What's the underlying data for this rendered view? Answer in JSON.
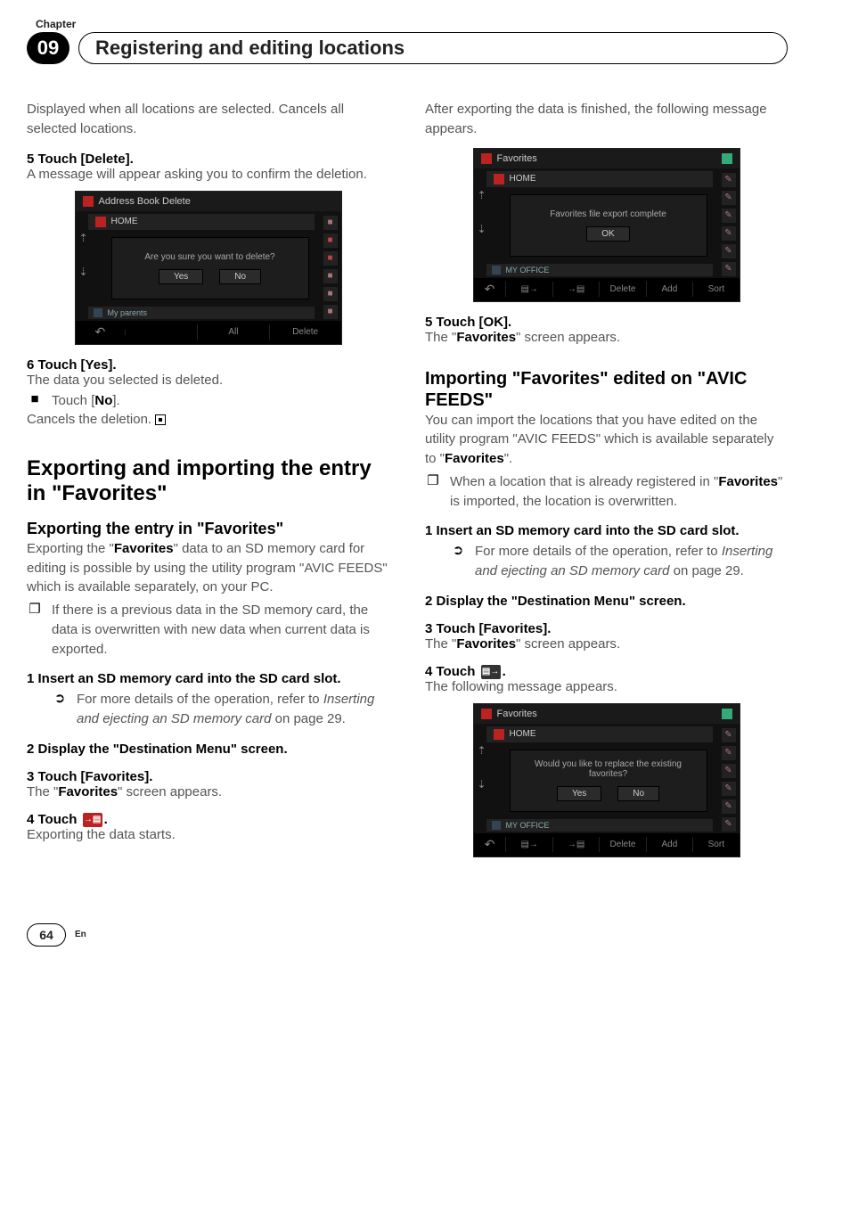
{
  "header": {
    "chapter_label": "Chapter",
    "chapter_number": "09",
    "title": "Registering and editing locations"
  },
  "left": {
    "intro": "Displayed when all locations are selected. Cancels all selected locations.",
    "step5_label": "5    Touch [Delete].",
    "step5_body": "A message will appear asking you to confirm the deletion.",
    "shot1": {
      "title": "Address Book Delete",
      "home": "HOME",
      "dialog_msg": "Are you sure you want to delete?",
      "yes": "Yes",
      "no": "No",
      "parents": "My parents",
      "footer_all": "All",
      "footer_delete": "Delete"
    },
    "step6_label": "6    Touch [Yes].",
    "step6_body": "The data you selected is deleted.",
    "bullet_touch_no_sym": "■",
    "bullet_touch_no": "Touch [",
    "bullet_touch_no_bold": "No",
    "bullet_touch_no_tail": "].",
    "cancels_deletion": "Cancels the deletion.",
    "h2": "Exporting and importing the entry in \"Favorites\"",
    "h3": "Exporting the entry in \"Favorites\"",
    "export_p1a": "Exporting the \"",
    "export_p1b": "Favorites",
    "export_p1c": "\" data to an SD memory card for editing is possible by using the utility program \"AVIC FEEDS\" which is available separately, on your PC.",
    "export_note_sym": "❐",
    "export_note": "If there is a previous data in the SD memory card, the data is overwritten with new data when current data is exported.",
    "step1_label": "1    Insert an SD memory card into the SD card slot.",
    "ref_sym": "➲",
    "ref_text_a": "For more details of the operation, refer to ",
    "ref_text_b": "Inserting and ejecting an SD memory card",
    "ref_text_c": " on page 29.",
    "step2_label": "2    Display the \"Destination Menu\" screen.",
    "step3_label": "3    Touch [Favorites].",
    "step3_body_a": "The \"",
    "step3_body_b": "Favorites",
    "step3_body_c": "\" screen appears.",
    "step4_label_a": "4    Touch ",
    "step4_label_b": ".",
    "step4_icon_glyph": "→▤",
    "step4_body": "Exporting the data starts."
  },
  "right": {
    "intro": "After exporting the data is finished, the following message appears.",
    "shot2": {
      "title": "Favorites",
      "home": "HOME",
      "dialog_msg": "Favorites file export complete",
      "ok": "OK",
      "office": "MY OFFICE",
      "f1": "▤→",
      "f2": "→▤",
      "f3": "Delete",
      "f4": "Add",
      "f5": "Sort"
    },
    "step5_label": "5    Touch [OK].",
    "step5_body_a": "The \"",
    "step5_body_b": "Favorites",
    "step5_body_c": "\" screen appears.",
    "h3": "Importing \"Favorites\" edited on \"AVIC FEEDS\"",
    "p1_a": "You can import the locations that you have edited on the utility program \"AVIC FEEDS\" which is available separately to \"",
    "p1_b": "Favorites",
    "p1_c": "\".",
    "note_sym": "❐",
    "note_a": "When a location that is already registered in \"",
    "note_b": "Favorites",
    "note_c": "\" is imported, the location is overwritten.",
    "step1_label": "1    Insert an SD memory card into the SD card slot.",
    "ref_sym": "➲",
    "ref_text_a": "For more details of the operation, refer to ",
    "ref_text_b": "Inserting and ejecting an SD memory card",
    "ref_text_c": " on page 29.",
    "step2_label": "2    Display the \"Destination Menu\" screen.",
    "step3_label": "3    Touch [Favorites].",
    "step3_body_a": "The \"",
    "step3_body_b": "Favorites",
    "step3_body_c": "\" screen appears.",
    "step4_label_a": "4    Touch ",
    "step4_label_b": ".",
    "step4_icon_glyph": "▤→",
    "step4_body": "The following message appears.",
    "shot3": {
      "title": "Favorites",
      "home": "HOME",
      "dialog_msg": "Would you like to replace the existing favorites?",
      "yes": "Yes",
      "no": "No",
      "office": "MY OFFICE",
      "f1": "▤→",
      "f2": "→▤",
      "f3": "Delete",
      "f4": "Add",
      "f5": "Sort"
    }
  },
  "footer": {
    "page_number": "64",
    "lang": "En"
  }
}
